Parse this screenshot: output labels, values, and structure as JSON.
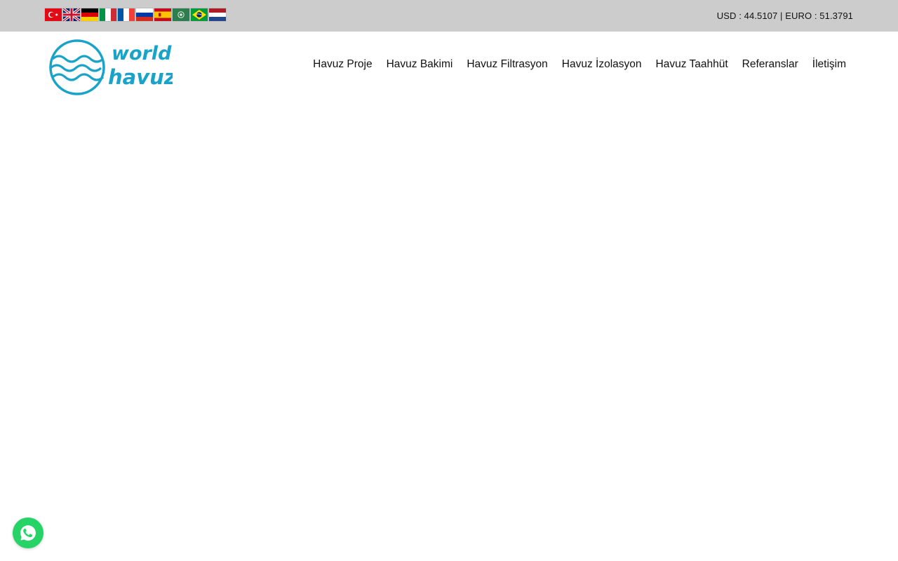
{
  "topbar": {
    "languages": [
      {
        "name": "Türkçe",
        "icon": "flag-tr-icon"
      },
      {
        "name": "English",
        "icon": "flag-en-icon"
      },
      {
        "name": "Deutsch",
        "icon": "flag-de-icon"
      },
      {
        "name": "Italiano",
        "icon": "flag-it-icon"
      },
      {
        "name": "Français",
        "icon": "flag-fr-icon"
      },
      {
        "name": "Русский",
        "icon": "flag-ru-icon"
      },
      {
        "name": "Español",
        "icon": "flag-es-icon"
      },
      {
        "name": "العربية",
        "icon": "flag-ar-icon"
      },
      {
        "name": "Português",
        "icon": "flag-pt-icon"
      },
      {
        "name": "Nederlands",
        "icon": "flag-nl-icon"
      }
    ],
    "currency_text": "USD : 44.5107 | EURO : 51.3791"
  },
  "logo": {
    "line1": "world",
    "line2": "havuz",
    "color": "#1aa3c9"
  },
  "nav": {
    "items": [
      {
        "label": "Havuz Proje"
      },
      {
        "label": "Havuz Bakimi"
      },
      {
        "label": "Havuz Filtrasyon"
      },
      {
        "label": "Havuz İzolasyon"
      },
      {
        "label": "Havuz Taahhüt"
      },
      {
        "label": "Referanslar"
      },
      {
        "label": "İletişim"
      }
    ]
  },
  "whatsapp": {
    "icon": "whatsapp-icon",
    "color": "#25d366"
  }
}
